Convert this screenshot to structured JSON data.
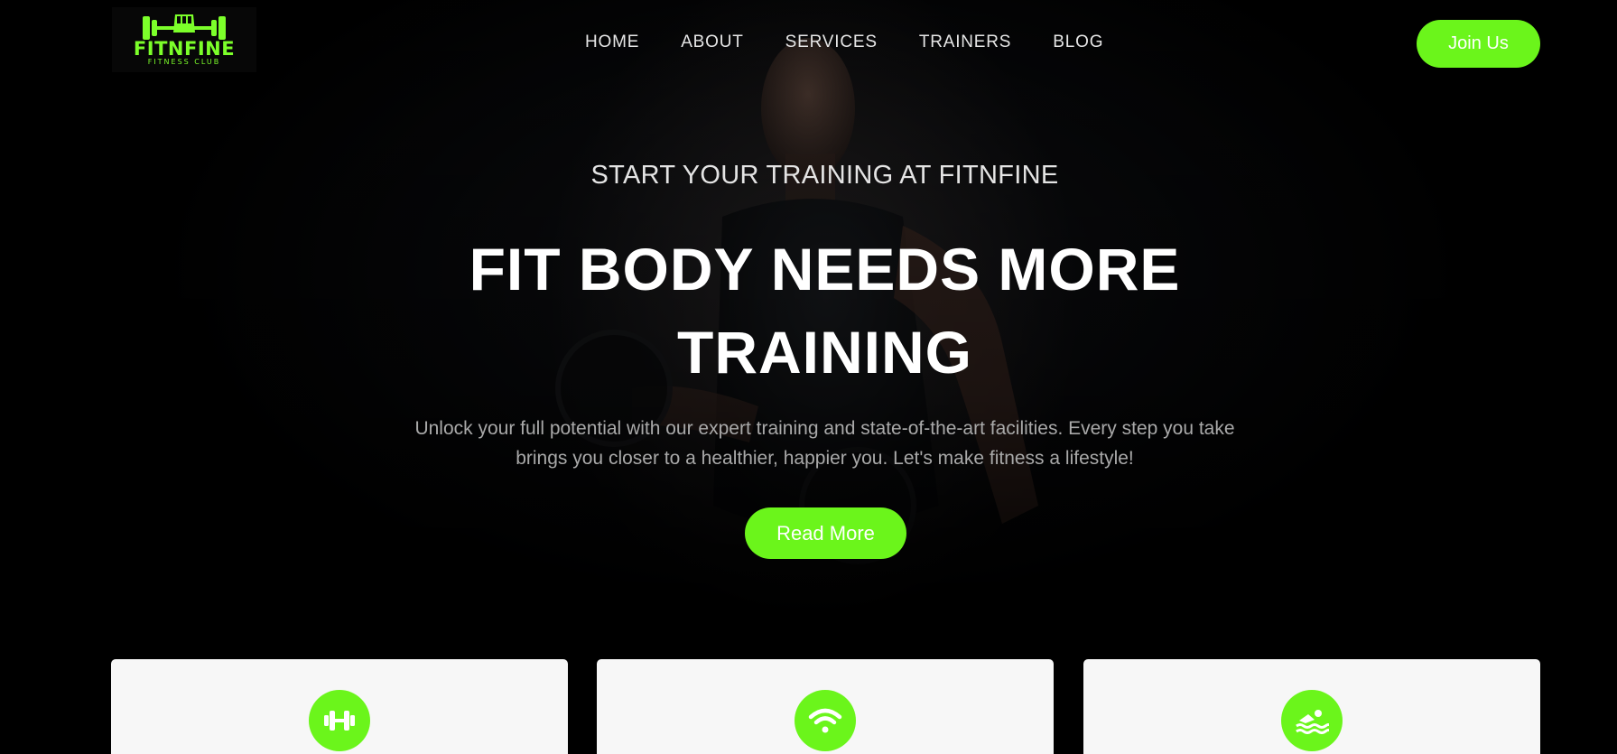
{
  "brand": {
    "name": "FITNFINE",
    "tagline": "FITNESS CLUB",
    "accent_color": "#6bf51b"
  },
  "nav": {
    "items": [
      "HOME",
      "ABOUT",
      "SERVICES",
      "TRAINERS",
      "BLOG"
    ],
    "cta_label": "Join Us"
  },
  "hero": {
    "eyebrow": "START YOUR TRAINING AT FITNFINE",
    "title_line1": "FIT BODY NEEDS MORE",
    "title_line2": "TRAINING",
    "description": "Unlock your full potential with our expert training and state-of-the-art facilities. Every step you take brings you closer to a healthier, happier you. Let's make fitness a lifestyle!",
    "button_label": "Read More"
  },
  "features": [
    {
      "icon": "dumbbell-icon"
    },
    {
      "icon": "wifi-icon"
    },
    {
      "icon": "swimming-icon"
    }
  ]
}
